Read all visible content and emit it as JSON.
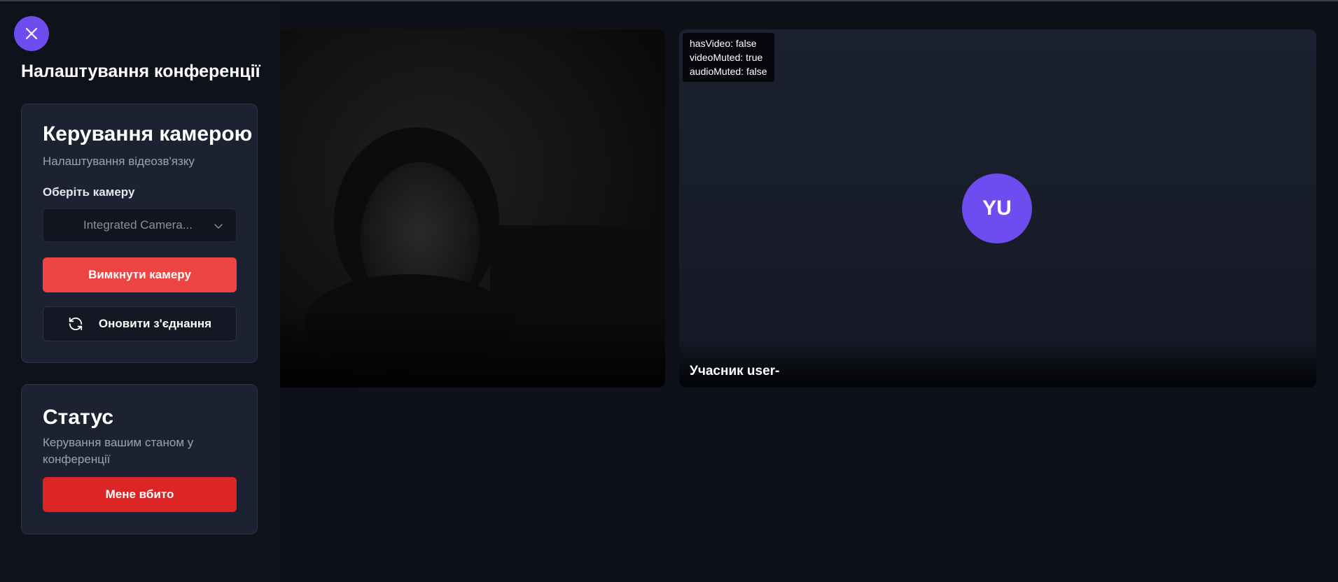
{
  "sidebar": {
    "title": "Налаштування конференції",
    "close_icon": "close-icon",
    "camera_card": {
      "title": "Керування камерою",
      "subtitle": "Налаштування відеозв'язку",
      "camera_label": "Оберіть камеру",
      "camera_selected": "Integrated Camera...",
      "disable_button": "Вимкнути камеру",
      "refresh_button": "Оновити з'єднання",
      "refresh_icon": "refresh-icon"
    },
    "status_card": {
      "title": "Статус",
      "subtitle": "Керування вашим станом у конференції",
      "killed_button": "Мене вбито"
    }
  },
  "remote_tile": {
    "debug": {
      "has_video": "hasVideo: false",
      "video_muted": "videoMuted: true",
      "audio_muted": "audioMuted: false"
    },
    "avatar_initials": "YU",
    "participant_name": "Учасник user-"
  },
  "colors": {
    "accent": "#6d4cf0",
    "danger": "#ef4444",
    "danger_dark": "#dc2626",
    "card_bg": "#1c2231",
    "page_bg": "#0f121a"
  }
}
